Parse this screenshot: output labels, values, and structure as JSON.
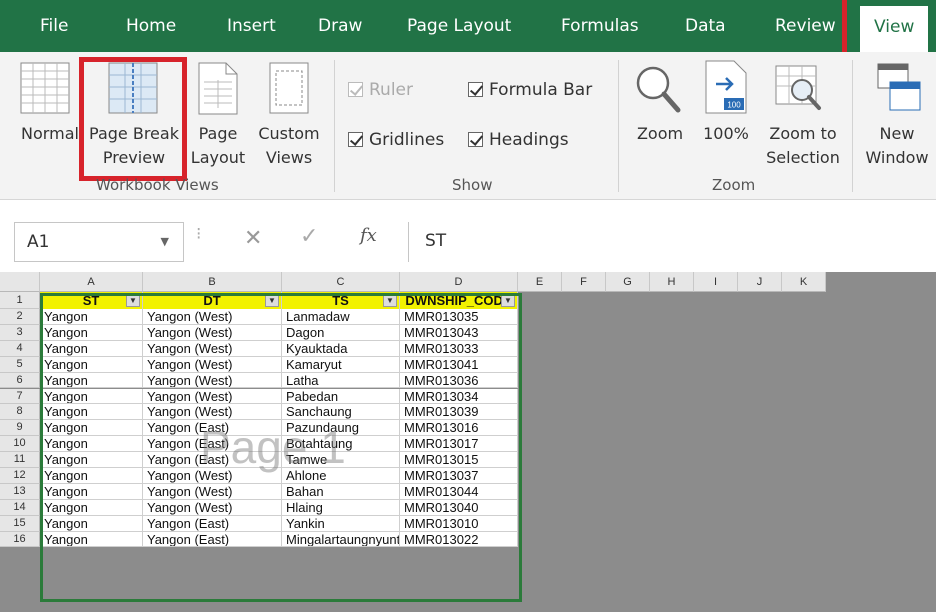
{
  "tabs": [
    "File",
    "Home",
    "Insert",
    "Draw",
    "Page Layout",
    "Formulas",
    "Data",
    "Review",
    "View"
  ],
  "ribbon": {
    "workbook_views": {
      "normal": "Normal",
      "page_break_1": "Page Break",
      "page_break_2": "Preview",
      "page_layout_1": "Page",
      "page_layout_2": "Layout",
      "custom_1": "Custom",
      "custom_2": "Views",
      "label": "Workbook Views"
    },
    "show": {
      "ruler": "Ruler",
      "formula_bar": "Formula Bar",
      "gridlines": "Gridlines",
      "headings": "Headings",
      "label": "Show"
    },
    "zoom": {
      "zoom": "Zoom",
      "hundred": "100%",
      "hundred_icon": "100",
      "zoom_sel_1": "Zoom to",
      "zoom_sel_2": "Selection",
      "label": "Zoom"
    },
    "window": {
      "new_1": "New",
      "new_2": "Window"
    }
  },
  "formula_bar": {
    "name_box": "A1",
    "fx": "fx",
    "content": "ST"
  },
  "grid": {
    "columns": [
      "A",
      "B",
      "C",
      "D",
      "E",
      "F",
      "G",
      "H",
      "I",
      "J",
      "K"
    ],
    "headers": [
      "ST",
      "DT",
      "TS",
      "DWNSHIP_CODE"
    ],
    "rows": [
      [
        "Yangon",
        "Yangon (West)",
        "Lanmadaw",
        "MMR013035"
      ],
      [
        "Yangon",
        "Yangon (West)",
        "Dagon",
        "MMR013043"
      ],
      [
        "Yangon",
        "Yangon (West)",
        "Kyauktada",
        "MMR013033"
      ],
      [
        "Yangon",
        "Yangon (West)",
        "Kamaryut",
        "MMR013041"
      ],
      [
        "Yangon",
        "Yangon (West)",
        "Latha",
        "MMR013036"
      ],
      [
        "Yangon",
        "Yangon (West)",
        "Pabedan",
        "MMR013034"
      ],
      [
        "Yangon",
        "Yangon (West)",
        "Sanchaung",
        "MMR013039"
      ],
      [
        "Yangon",
        "Yangon (East)",
        "Pazundaung",
        "MMR013016"
      ],
      [
        "Yangon",
        "Yangon (East)",
        "Botahtaung",
        "MMR013017"
      ],
      [
        "Yangon",
        "Yangon (East)",
        "Tamwe",
        "MMR013015"
      ],
      [
        "Yangon",
        "Yangon (West)",
        "Ahlone",
        "MMR013037"
      ],
      [
        "Yangon",
        "Yangon (West)",
        "Bahan",
        "MMR013044"
      ],
      [
        "Yangon",
        "Yangon (West)",
        "Hlaing",
        "MMR013040"
      ],
      [
        "Yangon",
        "Yangon (East)",
        "Yankin",
        "MMR013010"
      ],
      [
        "Yangon",
        "Yangon (East)",
        "Mingalartaungnyunt",
        "MMR013022"
      ]
    ],
    "watermark": "Page 1",
    "row_numbers": [
      "1",
      "2",
      "3",
      "4",
      "5",
      "6",
      "7",
      "8",
      "9",
      "10",
      "11",
      "12",
      "13",
      "14",
      "15",
      "16"
    ]
  },
  "colors": {
    "ribbon_green": "#217346",
    "highlight_red": "#d7232b",
    "header_yellow": "#f2f200",
    "print_area_green": "#2b7b3a"
  }
}
